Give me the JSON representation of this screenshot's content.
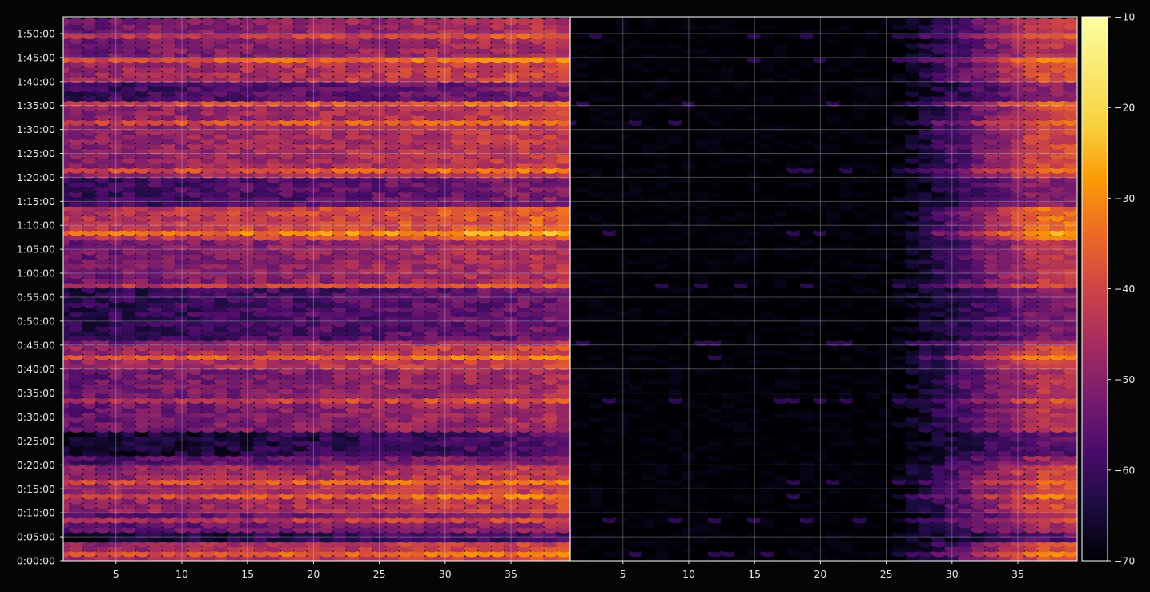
{
  "chart_data": {
    "type": "heatmap",
    "title": "",
    "xlabel": "",
    "ylabel": "",
    "panels": [
      {
        "name": "",
        "xlim": [
          1,
          39.5
        ],
        "xticks": [
          5,
          10,
          15,
          20,
          25,
          30,
          35,
          40
        ],
        "x_cells": 40,
        "base_level": -57,
        "active_from": 1
      },
      {
        "name": "",
        "xlim": [
          1,
          39.5
        ],
        "xticks": [
          5,
          10,
          15,
          20,
          25,
          30,
          35,
          40
        ],
        "x_cells": 40,
        "base_level": -72,
        "active_from": 26
      }
    ],
    "time_axis": {
      "range_seconds": [
        0,
        6810
      ],
      "row_step_seconds": 60,
      "tick_labels": [
        "0:00:00",
        "0:05:00",
        "0:10:00",
        "0:15:00",
        "0:20:00",
        "0:25:00",
        "0:30:00",
        "0:35:00",
        "0:40:00",
        "0:45:00",
        "0:50:00",
        "0:55:00",
        "1:00:00",
        "1:05:00",
        "1:10:00",
        "1:15:00",
        "1:20:00",
        "1:25:00",
        "1:30:00",
        "1:35:00",
        "1:40:00",
        "1:45:00",
        "1:50:00"
      ]
    },
    "colorbar": {
      "colormap": "inferno",
      "range": [
        -70,
        -10
      ],
      "tick_values": [
        -10,
        -20,
        -30,
        -40,
        -50,
        -60,
        -70
      ],
      "tick_labels": [
        "−10",
        "−20",
        "−30",
        "−40",
        "−50",
        "−60",
        "−70"
      ]
    },
    "intensity_bands": [
      {
        "from": 0,
        "to": 4,
        "level": -44
      },
      {
        "from": 4,
        "to": 5.5,
        "level": -62
      },
      {
        "from": 5.5,
        "to": 10,
        "level": -52
      },
      {
        "from": 10,
        "to": 20,
        "level": -45
      },
      {
        "from": 20,
        "to": 22,
        "level": -54
      },
      {
        "from": 22,
        "to": 27,
        "level": -62
      },
      {
        "from": 27,
        "to": 40,
        "level": -50
      },
      {
        "from": 40,
        "to": 45,
        "level": -44
      },
      {
        "from": 45,
        "to": 57,
        "level": -58
      },
      {
        "from": 57,
        "to": 67,
        "level": -49
      },
      {
        "from": 67,
        "to": 74,
        "level": -40
      },
      {
        "from": 74,
        "to": 80,
        "level": -56
      },
      {
        "from": 80,
        "to": 96,
        "level": -46
      },
      {
        "from": 96,
        "to": 100,
        "level": -56
      },
      {
        "from": 100,
        "to": 105,
        "level": -44
      },
      {
        "from": 105,
        "to": 114,
        "level": -49
      }
    ],
    "hot_rows_minutes": [
      1,
      8,
      13,
      16,
      33,
      42,
      45,
      57,
      68,
      81,
      91,
      95,
      104,
      109
    ],
    "background_level": -70
  },
  "colors": {
    "background": "#050505",
    "axes_text": "#e6e6e6"
  }
}
